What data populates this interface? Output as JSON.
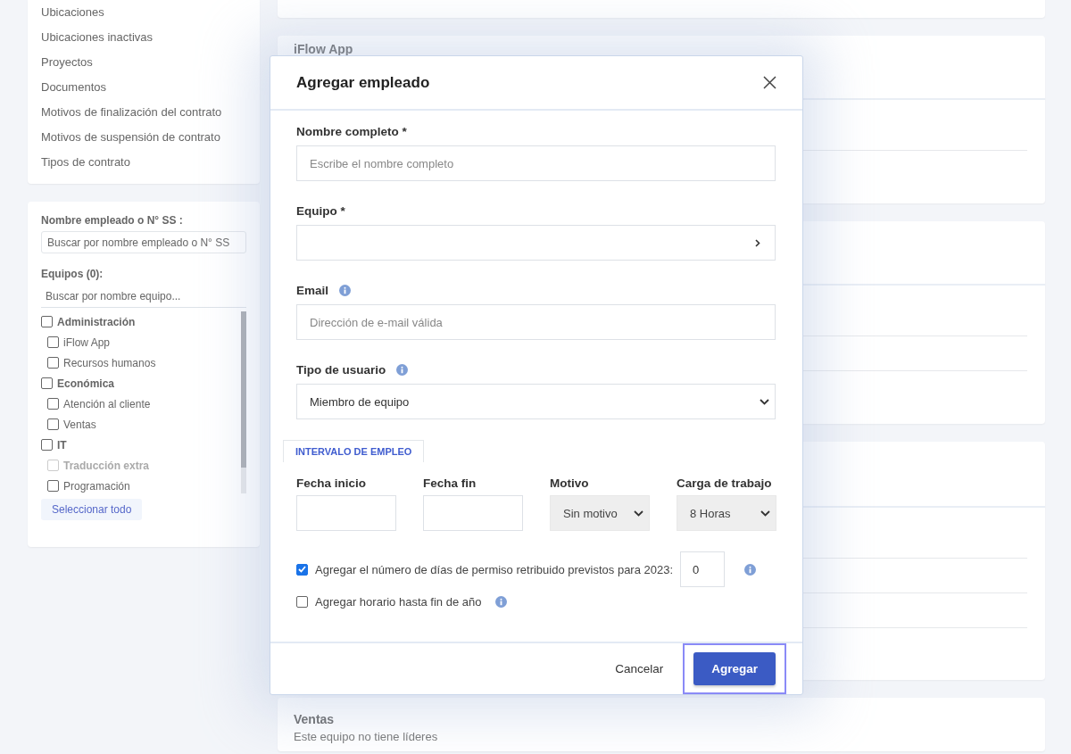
{
  "sidebar_menu": {
    "items": [
      "Ubicaciones",
      "Ubicaciones inactivas",
      "Proyectos",
      "Documentos",
      "Motivos de finalización del contrato",
      "Motivos de suspensión de contrato",
      "Tipos de contrato"
    ]
  },
  "filter": {
    "employee_label": "Nombre empleado o N° SS :",
    "employee_search": {
      "placeholder": "Buscar por nombre empleado o N° SS"
    },
    "teams_label": "Equipos (0):",
    "team_search": {
      "placeholder": "Buscar por nombre equipo..."
    },
    "teams": [
      {
        "label": "Administración",
        "checked": false,
        "disabled": false,
        "children": [
          {
            "label": "iFlow App",
            "checked": false,
            "disabled": false
          },
          {
            "label": "Recursos humanos",
            "checked": false,
            "disabled": false
          }
        ]
      },
      {
        "label": "Económica",
        "checked": false,
        "disabled": false,
        "children": [
          {
            "label": "Atención al cliente",
            "checked": false,
            "disabled": false
          },
          {
            "label": "Ventas",
            "checked": false,
            "disabled": false
          }
        ]
      },
      {
        "label": "IT",
        "checked": false,
        "disabled": false,
        "children": [
          {
            "label": "Traducción extra",
            "checked": false,
            "disabled": true
          },
          {
            "label": "Programación",
            "checked": false,
            "disabled": false
          }
        ]
      }
    ],
    "select_all": "Seleccionar todo"
  },
  "team_cards": [
    {
      "title": "iFlow App"
    },
    {
      "title": "Ventas",
      "subtitle": "Este equipo no tiene líderes"
    }
  ],
  "dialog": {
    "title": "Agregar empleado",
    "fields": [
      {
        "kind": "text",
        "label": "Nombre completo *",
        "info": false,
        "placeholder": "Escribe el nombre completo"
      },
      {
        "kind": "picker",
        "label": "Equipo *",
        "info": false
      },
      {
        "kind": "text",
        "label": "Email",
        "info": true,
        "placeholder": "Dirección de e-mail válida"
      },
      {
        "kind": "select",
        "label": "Tipo de usuario",
        "info": true,
        "value": "Miembro de equipo"
      }
    ],
    "section_tab": "INTERVALO DE EMPLEO",
    "interval_fields": [
      {
        "kind": "date",
        "label": "Fecha inicio"
      },
      {
        "kind": "date",
        "label": "Fecha fin"
      },
      {
        "kind": "select",
        "label": "Motivo",
        "value": "Sin motivo"
      },
      {
        "kind": "select",
        "label": "Carga de trabajo",
        "value": "8 Horas"
      }
    ],
    "options": [
      {
        "label": "Agregar el número de días de permiso retribuido previstos para 2023:",
        "checked": true,
        "value": "0",
        "info": true
      },
      {
        "label": "Agregar horario hasta fin de año",
        "checked": false,
        "info": true
      }
    ],
    "buttons": [
      {
        "kind": "link",
        "label": "Cancelar",
        "focused": false
      },
      {
        "kind": "primary",
        "label": "Agregar",
        "focused": true
      }
    ]
  }
}
